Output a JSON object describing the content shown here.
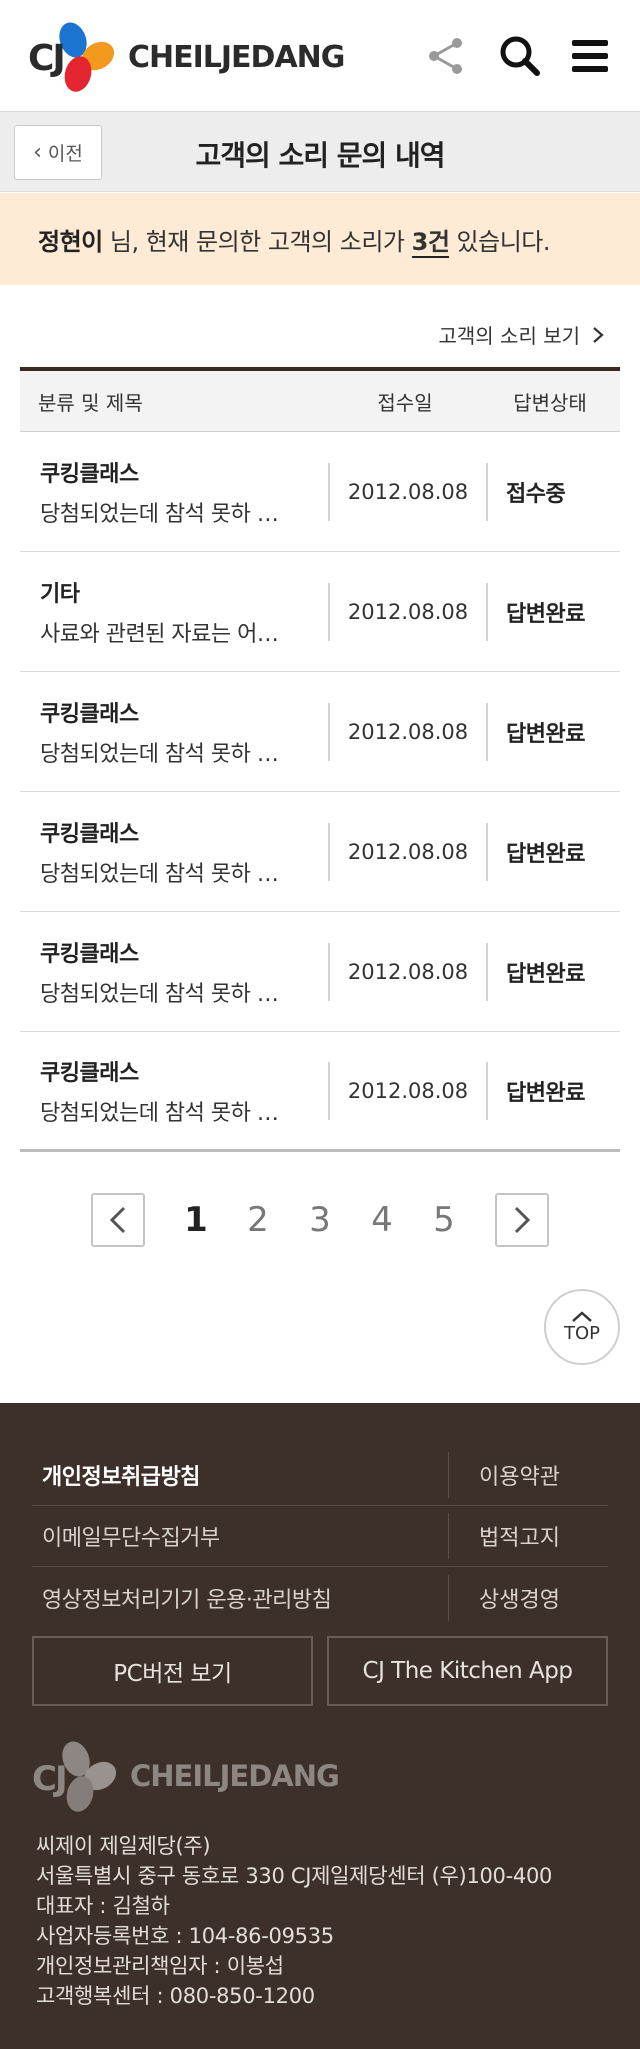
{
  "header": {
    "logo_cj": "CJ",
    "logo_text": "CHEILJEDANG",
    "brand_colors": {
      "blue": "#1b75d0",
      "red": "#e3252f",
      "orange": "#f29a1d"
    }
  },
  "titlebar": {
    "back_label": "이전",
    "title": "고객의 소리 문의 내역"
  },
  "notice": {
    "name": "정현이",
    "text_before": " 님, 현재 문의한 고객의 소리가 ",
    "count": "3건",
    "text_after": " 있습니다."
  },
  "view_link": {
    "label": "고객의 소리 보기"
  },
  "table": {
    "headers": {
      "title": "분류 및 제목",
      "date": "접수일",
      "status": "답변상태"
    },
    "rows": [
      {
        "category": "쿠킹클래스",
        "subject": "당첨되었는데 참석 못하 …",
        "date": "2012.08.08",
        "status": "접수중"
      },
      {
        "category": "기타",
        "subject": "사료와 관련된 자료는 어…",
        "date": "2012.08.08",
        "status": "답변완료"
      },
      {
        "category": "쿠킹클래스",
        "subject": "당첨되었는데 참석 못하 …",
        "date": "2012.08.08",
        "status": "답변완료"
      },
      {
        "category": "쿠킹클래스",
        "subject": "당첨되었는데 참석 못하 …",
        "date": "2012.08.08",
        "status": "답변완료"
      },
      {
        "category": "쿠킹클래스",
        "subject": "당첨되었는데 참석 못하 …",
        "date": "2012.08.08",
        "status": "답변완료"
      },
      {
        "category": "쿠킹클래스",
        "subject": "당첨되었는데 참석 못하 …",
        "date": "2012.08.08",
        "status": "답변완료"
      }
    ]
  },
  "pagination": {
    "pages": [
      "1",
      "2",
      "3",
      "4",
      "5"
    ],
    "current": "1"
  },
  "top_button": {
    "label": "TOP"
  },
  "footer": {
    "links": [
      {
        "left": "개인정보취급방침",
        "right": "이용약관"
      },
      {
        "left": "이메일무단수집거부",
        "right": "법적고지"
      },
      {
        "left": "영상정보처리기기 운용·관리방침",
        "right": "상생경영"
      }
    ],
    "pc_button": "PC버전 보기",
    "app_button": "CJ The Kitchen App",
    "logo_cj": "CJ",
    "logo_text": "CHEILJEDANG",
    "info": [
      "씨제이 제일제당(주)",
      "서울특별시 중구 동호로 330 CJ제일제당센터 (우)100-400",
      "대표자 : 김철하",
      "사업자등록번호 : 104-86-09535",
      "개인정보관리책임자 : 이봉섭",
      "고객행복센터 : 080-850-1200"
    ]
  }
}
